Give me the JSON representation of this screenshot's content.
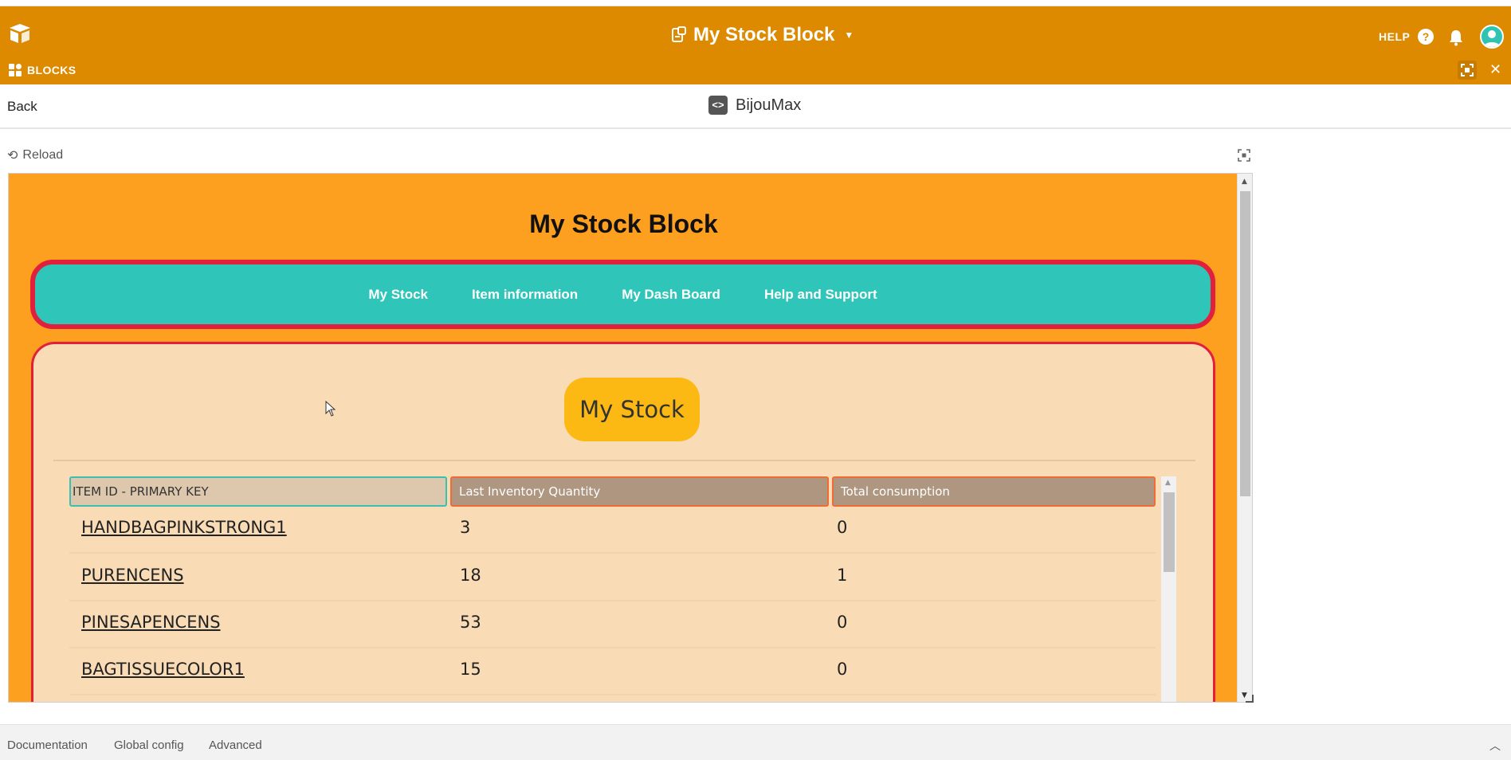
{
  "app": {
    "base_title": "My Stock Block",
    "help_label": "HELP",
    "blocks_label": "BLOCKS",
    "icons": [
      "airtable-logo-icon",
      "base-icon",
      "chevron-down-icon",
      "help-icon",
      "bell-icon",
      "avatar",
      "blocks-icon",
      "fullscreen-icon",
      "close-icon"
    ]
  },
  "block": {
    "back_label": "Back",
    "name": "BijouMax",
    "reload_label": "Reload"
  },
  "frame": {
    "title": "My Stock Block",
    "nav": [
      "My Stock",
      "Item information",
      "My Dash Board",
      "Help and Support"
    ],
    "section_title": "My Stock",
    "table": {
      "columns": [
        "ITEM ID - PRIMARY KEY",
        "Last Inventory Quantity",
        "Total consumption"
      ],
      "rows": [
        {
          "id": "HANDBAGPINKSTRONG1",
          "qty": "3",
          "consumption": "0"
        },
        {
          "id": "PURENCENS",
          "qty": "18",
          "consumption": "1"
        },
        {
          "id": "PINESAPENCENS",
          "qty": "53",
          "consumption": "0"
        },
        {
          "id": "BAGTISSUECOLOR1",
          "qty": "15",
          "consumption": "0"
        }
      ]
    }
  },
  "footer": {
    "links": [
      "Documentation",
      "Global config",
      "Advanced"
    ]
  },
  "colors": {
    "appbar": "#de8a00",
    "frame_bg": "#fea01f",
    "nav_bg": "#2fc5b8",
    "border_red": "#e21f3c",
    "panel_bg": "#f9dcb6",
    "pill": "#fdb913"
  }
}
